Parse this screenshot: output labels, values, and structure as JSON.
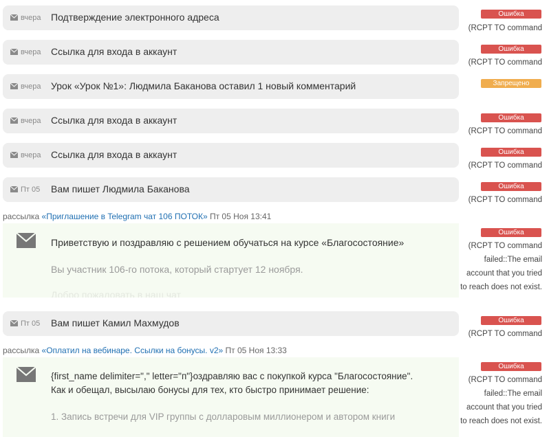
{
  "colors": {
    "error": "#d9534f",
    "denied": "#f0ad4e",
    "link": "#1f6fb2",
    "row_bg": "#eeeeee",
    "message_bg": "#f6fbf2"
  },
  "icons": {
    "envelope": "envelope-icon"
  },
  "emails": [
    {
      "date": "вчера",
      "subject": "Подтверждение электронного адреса",
      "status": "Ошибка",
      "error_text": "(RCPT TO command"
    },
    {
      "date": "вчера",
      "subject": "Ссылка для входа в аккаунт",
      "status": "Ошибка",
      "error_text": "(RCPT TO command"
    },
    {
      "date": "вчера",
      "subject": "Урок «Урок №1»: Людмила Баканова оставил 1 новый комментарий",
      "status": "Запрещено"
    },
    {
      "date": "вчера",
      "subject": "Ссылка для входа в аккаунт",
      "status": "Ошибка",
      "error_text": "(RCPT TO command"
    },
    {
      "date": "вчера",
      "subject": "Ссылка для входа в аккаунт",
      "status": "Ошибка",
      "error_text": "(RCPT TO command"
    },
    {
      "date": "Пт 05",
      "subject": "Вам пишет Людмила Баканова",
      "status": "Ошибка",
      "error_text": "(RCPT TO command"
    }
  ],
  "campaign1": {
    "prefix": "рассылка",
    "name": "«Приглашение в Telegram чат 106 ПОТОК»",
    "datetime": "Пт 05 Ноя 13:41",
    "line1": "Приветствую и поздравляю с решением обучаться на курсе «Благосостояние»",
    "line2": "Вы участник 106-го потока, который стартует 12 ноября.",
    "status": "Ошибка",
    "error_lines": [
      "(RCPT TO command",
      "failed::The email",
      "account that you tried",
      "to reach does not exist."
    ]
  },
  "email7": {
    "date": "Пт 05",
    "subject": "Вам пишет Камил Махмудов",
    "status": "Ошибка",
    "error_text": "(RCPT TO command"
  },
  "campaign2": {
    "prefix": "рассылка",
    "name": "«Оплатил на вебинаре. Ссылки на бонусы. v2»",
    "datetime": "Пт 05 Ноя 13:33",
    "line1": "{first_name delimiter=\",\" letter=\"п\"}оздравляю вас с покупкой курса \"Благосостояние\".",
    "line2": "Как и обещал, высылаю бонусы для тех, кто быстро принимает решение:",
    "line3": "1. Запись встречи для VIP группы с долларовым миллионером и автором книги",
    "status": "Ошибка",
    "error_lines": [
      "(RCPT TO command",
      "failed::The email",
      "account that you tried",
      "to reach does not exist."
    ]
  }
}
